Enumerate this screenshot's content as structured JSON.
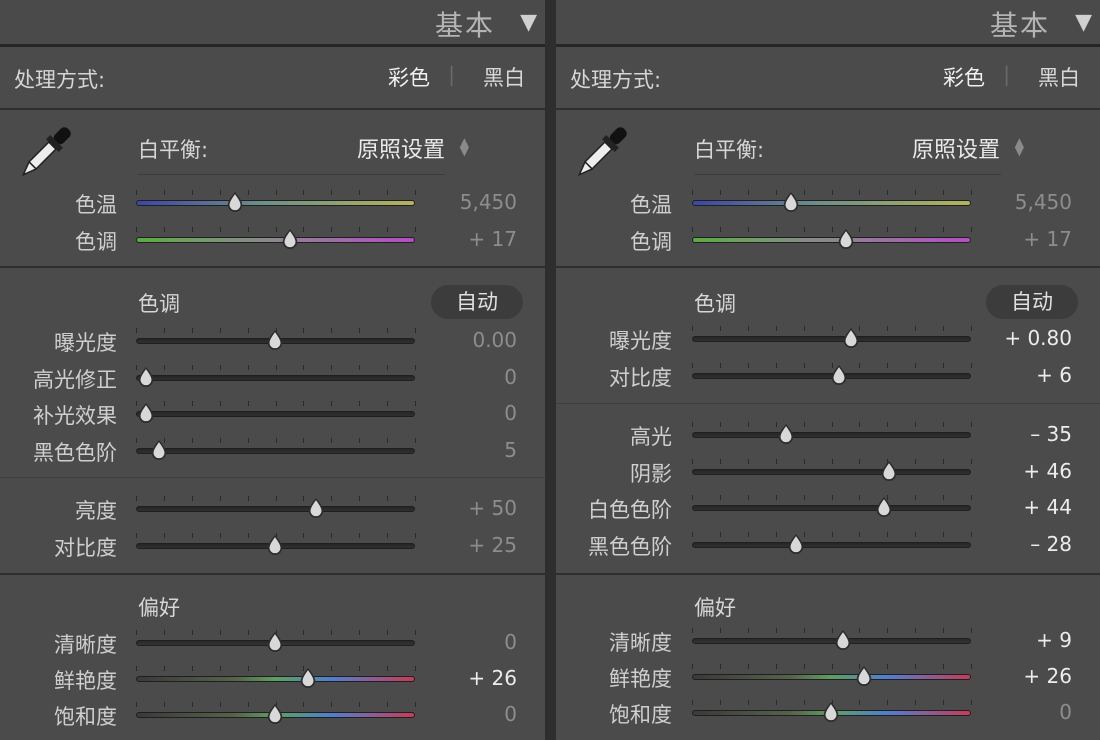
{
  "panels": [
    {
      "header": {
        "title": "基本",
        "collapse_icon": "triangle-down-icon"
      },
      "treatment": {
        "label": "处理方式:",
        "color": "彩色",
        "bw": "黑白"
      },
      "wb": {
        "label": "白平衡:",
        "value": "原照设置",
        "icon": "eyedropper-icon"
      },
      "wb_sliders": [
        {
          "label": "色温",
          "value": "5,450",
          "pos": 0.36,
          "track": "temp"
        },
        {
          "label": "色调",
          "value": "+ 17",
          "pos": 0.555,
          "track": "tint"
        }
      ],
      "tone": {
        "title": "色调",
        "auto": "自动"
      },
      "tone_sliders": [
        {
          "label": "曝光度",
          "value": "0.00",
          "pos": 0.5
        },
        {
          "label": "高光修正",
          "value": "0",
          "pos": 0.04
        },
        {
          "label": "补光效果",
          "value": "0",
          "pos": 0.04
        },
        {
          "label": "黑色色阶",
          "value": "5",
          "pos": 0.085
        }
      ],
      "tone_sliders2": [
        {
          "label": "亮度",
          "value": "+ 50",
          "pos": 0.65
        },
        {
          "label": "对比度",
          "value": "+ 25",
          "pos": 0.5
        }
      ],
      "presence": {
        "title": "偏好"
      },
      "presence_sliders": [
        {
          "label": "清晰度",
          "value": "0",
          "pos": 0.5,
          "track": "gray"
        },
        {
          "label": "鲜艳度",
          "value": "+ 26",
          "pos": 0.62,
          "track": "color",
          "bright": true
        },
        {
          "label": "饱和度",
          "value": "0",
          "pos": 0.5,
          "track": "color"
        }
      ]
    },
    {
      "header": {
        "title": "基本",
        "collapse_icon": "triangle-down-icon"
      },
      "treatment": {
        "label": "处理方式:",
        "color": "彩色",
        "bw": "黑白"
      },
      "wb": {
        "label": "白平衡:",
        "value": "原照设置",
        "icon": "eyedropper-icon"
      },
      "wb_sliders": [
        {
          "label": "色温",
          "value": "5,450",
          "pos": 0.36,
          "track": "temp"
        },
        {
          "label": "色调",
          "value": "+ 17",
          "pos": 0.555,
          "track": "tint"
        }
      ],
      "tone": {
        "title": "色调",
        "auto": "自动"
      },
      "tone_sliders": [
        {
          "label": "曝光度",
          "value": "+ 0.80",
          "pos": 0.575,
          "bright": true
        },
        {
          "label": "对比度",
          "value": "+ 6",
          "pos": 0.53,
          "bright": true
        }
      ],
      "tone_sliders2": [
        {
          "label": "高光",
          "value": "– 35",
          "pos": 0.34,
          "bright": true
        },
        {
          "label": "阴影",
          "value": "+ 46",
          "pos": 0.71,
          "bright": true
        },
        {
          "label": "白色色阶",
          "value": "+ 44",
          "pos": 0.69,
          "bright": true
        },
        {
          "label": "黑色色阶",
          "value": "– 28",
          "pos": 0.375,
          "bright": true
        }
      ],
      "presence": {
        "title": "偏好"
      },
      "presence_sliders": [
        {
          "label": "清晰度",
          "value": "+ 9",
          "pos": 0.545,
          "track": "gray",
          "bright": true
        },
        {
          "label": "鲜艳度",
          "value": "+ 26",
          "pos": 0.62,
          "track": "color",
          "bright": true
        },
        {
          "label": "饱和度",
          "value": "0",
          "pos": 0.5,
          "track": "color"
        }
      ]
    }
  ],
  "colors": {
    "panel_bg": "#4b4b4b",
    "separator": "#2f2f2f",
    "track_dark": "#2a2a2a"
  }
}
